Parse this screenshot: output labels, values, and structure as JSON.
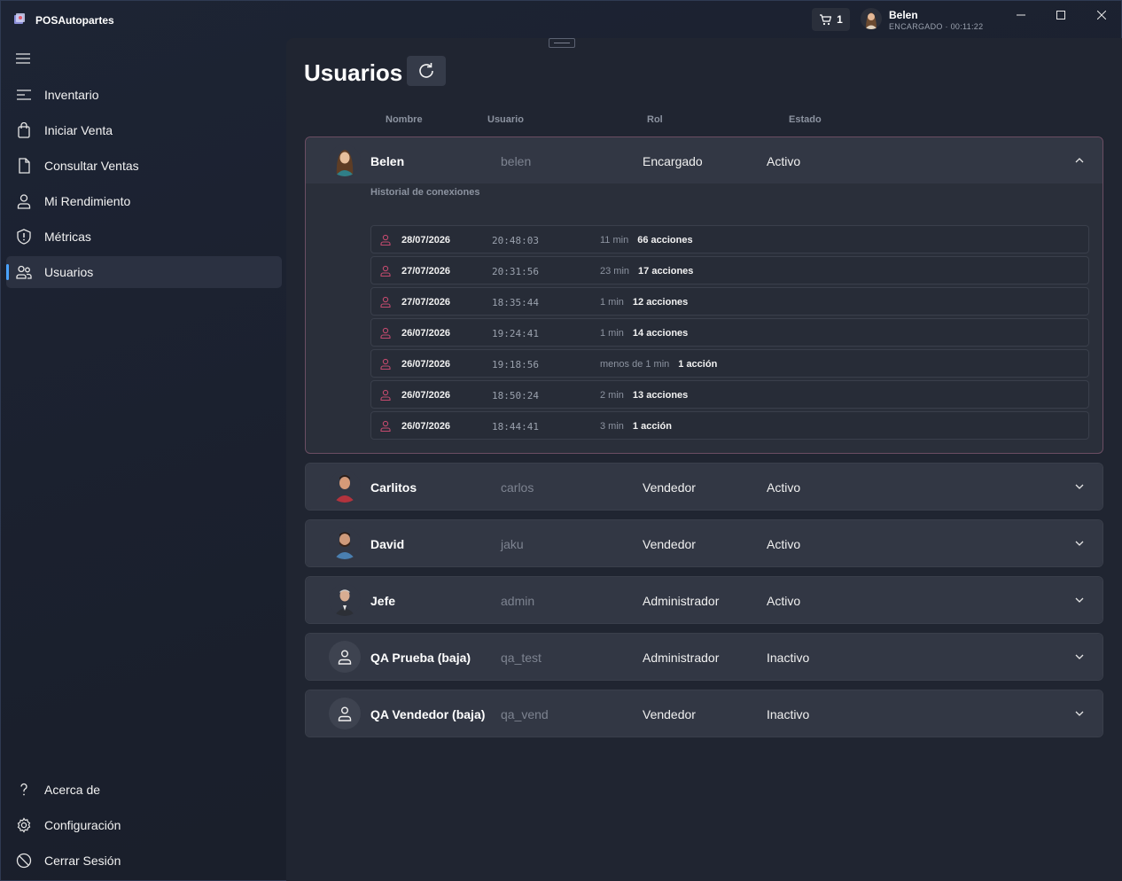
{
  "app": {
    "title": "POSAutopartes",
    "cart_count": "1",
    "user_name": "Belen",
    "user_role": "ENCARGADO",
    "session_time": "00:11:22"
  },
  "sidebar": {
    "items": [
      {
        "label": "Inventario",
        "icon": "list-icon"
      },
      {
        "label": "Iniciar Venta",
        "icon": "shopping-bag-icon"
      },
      {
        "label": "Consultar Ventas",
        "icon": "document-icon"
      },
      {
        "label": "Mi Rendimiento",
        "icon": "person-icon"
      },
      {
        "label": "Métricas",
        "icon": "shield-icon"
      },
      {
        "label": "Usuarios",
        "icon": "people-icon",
        "active": true
      }
    ],
    "footer": [
      {
        "label": "Acerca de",
        "icon": "question-icon"
      },
      {
        "label": "Configuración",
        "icon": "gear-icon"
      },
      {
        "label": "Cerrar Sesión",
        "icon": "logout-icon"
      }
    ]
  },
  "main": {
    "title": "Usuarios",
    "columns": [
      "Nombre",
      "Usuario",
      "Rol",
      "Estado"
    ],
    "history_title": "Historial de conexiones",
    "users": [
      {
        "name": "Belen",
        "username": "belen",
        "role": "Encargado",
        "status": "Activo",
        "expanded": true
      },
      {
        "name": "Carlitos",
        "username": "carlos",
        "role": "Vendedor",
        "status": "Activo"
      },
      {
        "name": "David",
        "username": "jaku",
        "role": "Vendedor",
        "status": "Activo"
      },
      {
        "name": "Jefe",
        "username": "admin",
        "role": "Administrador",
        "status": "Activo"
      },
      {
        "name": "QA Prueba (baja)",
        "username": "qa_test",
        "role": "Administrador",
        "status": "Inactivo"
      },
      {
        "name": "QA Vendedor (baja)",
        "username": "qa_vend",
        "role": "Vendedor",
        "status": "Inactivo"
      }
    ],
    "history": [
      {
        "date": "28/07/2026",
        "time": "20:48:03",
        "duration": "11 min",
        "actions": "66 acciones"
      },
      {
        "date": "27/07/2026",
        "time": "20:31:56",
        "duration": "23 min",
        "actions": "17 acciones"
      },
      {
        "date": "27/07/2026",
        "time": "18:35:44",
        "duration": "1 min",
        "actions": "12 acciones"
      },
      {
        "date": "26/07/2026",
        "time": "19:24:41",
        "duration": "1 min",
        "actions": "14 acciones"
      },
      {
        "date": "26/07/2026",
        "time": "19:18:56",
        "duration": "menos de 1 min",
        "actions": "1 acción"
      },
      {
        "date": "26/07/2026",
        "time": "18:50:24",
        "duration": "2 min",
        "actions": "13 acciones"
      },
      {
        "date": "26/07/2026",
        "time": "18:44:41",
        "duration": "3 min",
        "actions": "1 acción"
      }
    ]
  }
}
